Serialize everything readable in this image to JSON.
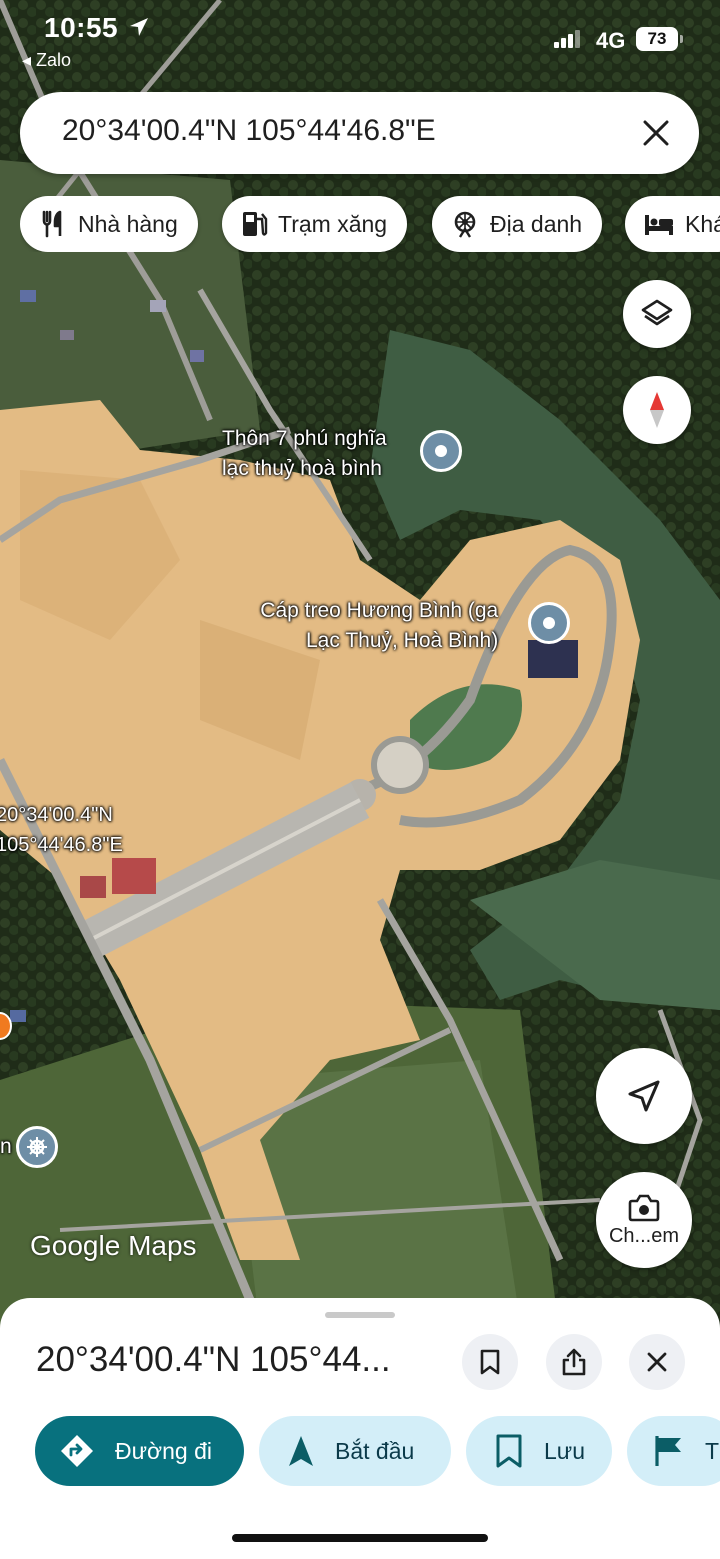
{
  "status_bar": {
    "time": "10:55",
    "back_app": "◂ Zalo",
    "network": "4G",
    "battery": "73"
  },
  "search": {
    "query": "20°34'00.4\"N 105°44'46.8\"E"
  },
  "chips": [
    {
      "label": "Nhà hàng",
      "icon": "restaurant-icon"
    },
    {
      "label": "Trạm xăng",
      "icon": "gas-station-icon"
    },
    {
      "label": "Địa danh",
      "icon": "landmark-icon"
    },
    {
      "label": "Khá",
      "icon": "hotel-icon"
    }
  ],
  "map": {
    "place1": {
      "line1": "Thôn 7 phú nghĩa",
      "line2": "lạc thuỷ hoà bình"
    },
    "place2": {
      "line1": "Cáp treo Hương Bình (ga",
      "line2": "Lạc Thuỷ, Hoà Bình)"
    },
    "pin_label": {
      "line1": "20°34'00.4\"N",
      "line2": "105°44'46.8\"E"
    },
    "edge_label": "n",
    "watermark": "Google Maps",
    "street_view_label": "Ch...em"
  },
  "sheet": {
    "title": "20°34'00.4\"N 105°44...",
    "actions": [
      {
        "label": "Đường đi",
        "icon": "directions-icon"
      },
      {
        "label": "Bắt đầu",
        "icon": "navigation-arrow-icon"
      },
      {
        "label": "Lưu",
        "icon": "bookmark-icon"
      },
      {
        "label": "T",
        "icon": "flag-icon"
      }
    ]
  },
  "colors": {
    "primary_action": "#08717e",
    "secondary_action": "#d3eef8",
    "pin": "#6e8ea6"
  }
}
